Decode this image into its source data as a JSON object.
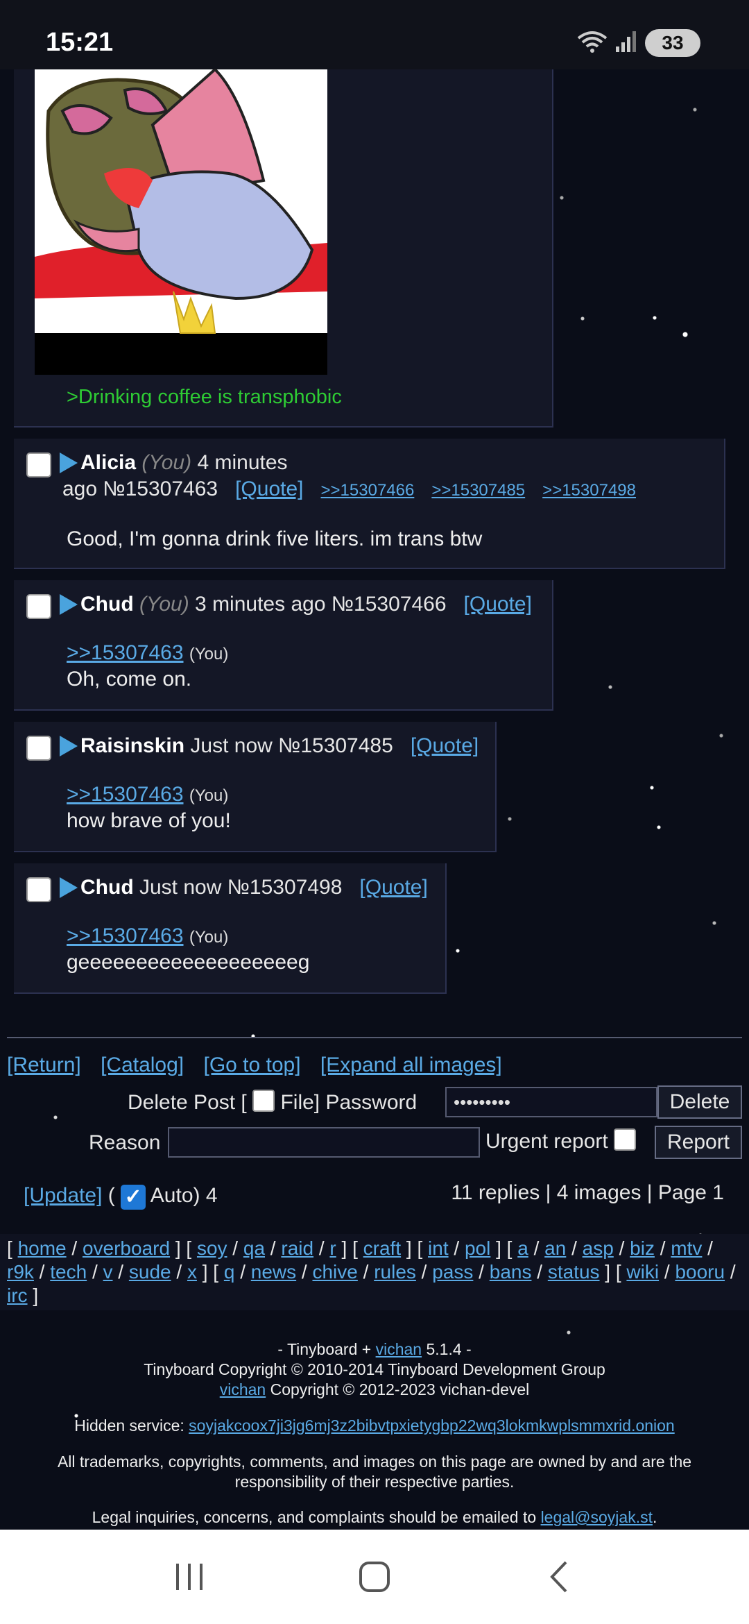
{
  "status_bar": {
    "time": "15:21",
    "battery": "33"
  },
  "op": {
    "greentext": ">Drinking coffee is transphobic",
    "image_alt": "wojak drinking coffee"
  },
  "replies": [
    {
      "name": "Alicia",
      "you": "(You)",
      "time_a": "4 minutes",
      "time_b": "ago",
      "number": "№15307463",
      "quote": "[Quote]",
      "backlinks": [
        ">>15307466",
        ">>15307485",
        ">>15307498"
      ],
      "body": "Good, I'm gonna drink five liters. im trans btw"
    },
    {
      "name": "Chud",
      "you": "(You)",
      "time": "3 minutes ago",
      "number": "№15307466",
      "quote": "[Quote]",
      "ref": ">>15307463",
      "ref_you": "(You)",
      "body": "Oh, come on."
    },
    {
      "name": "Raisinskin",
      "time": "Just now",
      "number": "№15307485",
      "quote": "[Quote]",
      "ref": ">>15307463",
      "ref_you": "(You)",
      "body": "how brave of you!"
    },
    {
      "name": "Chud",
      "time": "Just now",
      "number": "№15307498",
      "quote": "[Quote]",
      "ref": ">>15307463",
      "ref_you": "(You)",
      "body": "geeeeeeeeeeeeeeeeeeeg"
    }
  ],
  "nav": {
    "return": "[Return]",
    "catalog": "[Catalog]",
    "top": "[Go to top]",
    "expand": "[Expand all images]"
  },
  "form": {
    "delete_post": "Delete Post [",
    "file": "File] Password",
    "password_value": "•••••••••",
    "delete_btn": "Delete",
    "reason": "Reason",
    "urgent": "Urgent report",
    "report_btn": "Report"
  },
  "update": {
    "update_link": "[Update]",
    "open_paren": "(",
    "auto": "Auto) 4",
    "stats": "11 replies | 4 images | Page 1"
  },
  "boards": {
    "groups": [
      [
        "home",
        "overboard"
      ],
      [
        "soy",
        "qa",
        "raid",
        "r"
      ],
      [
        "craft"
      ],
      [
        "int",
        "pol"
      ],
      [
        "a",
        "an",
        "asp",
        "biz",
        "mtv",
        "r9k",
        "tech",
        "v",
        "sude",
        "x"
      ],
      [
        "q",
        "news",
        "chive",
        "rules",
        "pass",
        "bans",
        "status"
      ],
      [
        "wiki",
        "booru",
        "irc"
      ]
    ]
  },
  "footer": {
    "line1_prefix": "- Tinyboard + ",
    "line1_link": "vichan",
    "line1_suffix": " 5.1.4 -",
    "line2": "Tinyboard Copyright © 2010-2014 Tinyboard Development Group",
    "line3_link": "vichan",
    "line3_suffix": " Copyright © 2012-2023 vichan-devel",
    "hidden_label": "Hidden service: ",
    "hidden_link": "soyjakcoox7ji3jg6mj3z2bibvtpxietygbp22wq3lokmkwplsmmxrid.onion",
    "trademark_1": "All trademarks, copyrights, comments, and images on this page are owned by and are the",
    "trademark_2": "responsibility of their respective parties.",
    "legal_prefix": "Legal inquiries, concerns, and complaints should be emailed to ",
    "legal_link": "legal@soyjak.st",
    "legal_suffix": "."
  }
}
